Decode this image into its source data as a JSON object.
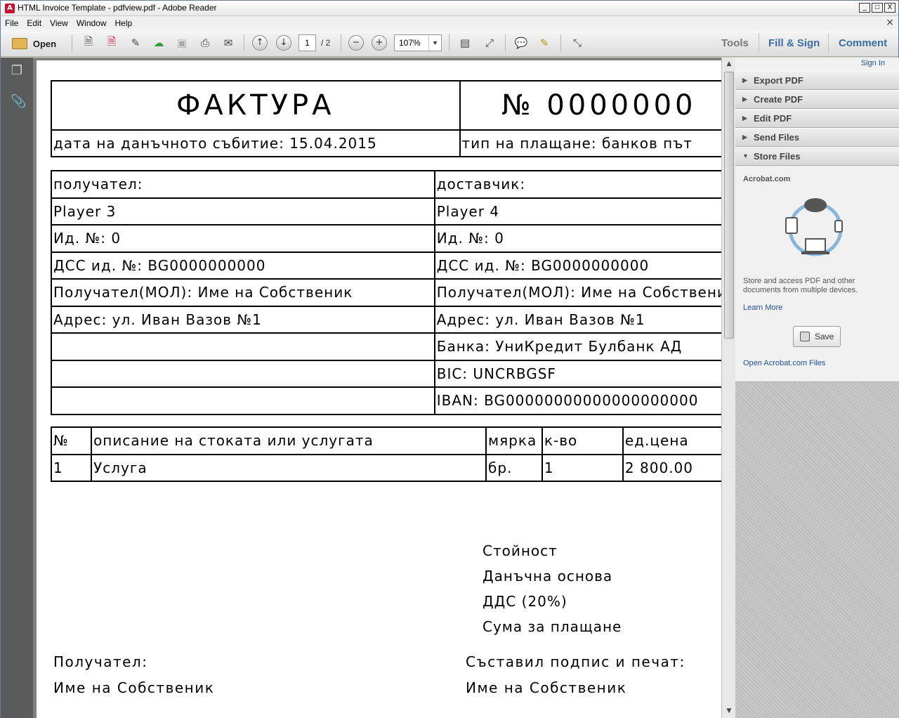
{
  "window": {
    "title": "HTML Invoice Template - pdfview.pdf - Adobe Reader",
    "min": "_",
    "max": "□",
    "close": "X"
  },
  "menu": [
    "File",
    "Edit",
    "View",
    "Window",
    "Help"
  ],
  "menu_close": "×",
  "toolbar": {
    "open_label": "Open",
    "page_current": "1",
    "page_total": "/ 2",
    "zoom": "107%"
  },
  "tabs": {
    "tools": "Tools",
    "fill_sign": "Fill & Sign",
    "comment": "Comment"
  },
  "sidebar": {
    "sign_in": "Sign In",
    "sections": [
      "Export PDF",
      "Create PDF",
      "Edit PDF",
      "Send Files",
      "Store Files"
    ],
    "store": {
      "title": "Acrobat.com",
      "text": "Store and access PDF and other documents from multiple devices.",
      "learn_more": "Learn More",
      "save": "Save",
      "open_files": "Open Acrobat.com Files"
    }
  },
  "invoice": {
    "title": "ФАКТУРА",
    "number": "№ 0000000",
    "tax_date": "дата на данъчното събитие: 15.04.2015",
    "payment_type": "тип на плащане: банков път",
    "recipient": {
      "heading": "получател:",
      "name": "Player 3",
      "id": "Ид. №: 0",
      "vat": "ДСС ид. №: BG0000000000",
      "mol": "Получател(МОЛ): Име на Собственик",
      "address": "Адрес: ул. Иван Вазов №1"
    },
    "supplier": {
      "heading": "доставчик:",
      "name": "Player 4",
      "id": "Ид. №: 0",
      "vat": "ДСС ид. №: BG0000000000",
      "mol": "Получател(МОЛ): Име на Собственик",
      "address": "Адрес: ул. Иван Вазов №1",
      "bank": "Банка: УниКредит Булбанк АД",
      "bic": "BIC: UNCRBGSF",
      "iban": "IBAN: BG00000000000000000000"
    },
    "items_header": [
      "№",
      "описание на стоката или услугата",
      "мярка",
      "к-во",
      "ед.цена"
    ],
    "items": [
      [
        "1",
        "Услуга",
        "бр.",
        "1",
        "2 800.00"
      ]
    ],
    "totals": [
      "Стойност",
      "Данъчна основа",
      "ДДС (20%)",
      "Сума за плащане"
    ],
    "sign_left": {
      "label": "Получател:",
      "name": "Име на Собственик"
    },
    "sign_right": {
      "label": "Съставил подпис и печат:",
      "name": "Име на Собственик"
    }
  }
}
